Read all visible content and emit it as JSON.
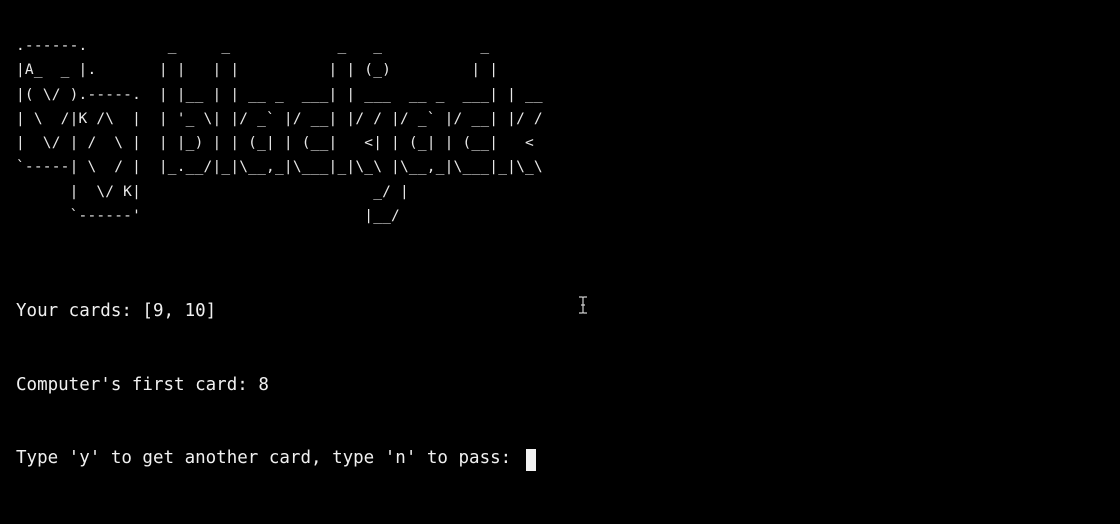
{
  "terminal": {
    "ascii_art": [
      ".------.         _     _            _   _           _",
      "|A_  _ |.       | |   | |          | | (_)         | |",
      "|( \\/ ).-----.  | |__ | | __ _  ___| | ___  __ _  ___| | __",
      "| \\  /|K /\\  |  | '_ \\| |/ _` |/ __| |/ / |/ _` |/ __| |/ /",
      "|  \\/ | /  \\ |  | |_) | | (_| | (__|   <| | (_| | (__|   <",
      "`-----| \\  / |  |_.__/|_|\\__,_|\\___|_|\\_\\ |\\__,_|\\___|_|\\_\\",
      "      |  \\/ K|                          _/ |",
      "      `------'                         |__/"
    ],
    "output_lines": [
      "Your cards: [9, 10]",
      "Computer's first card: 8"
    ],
    "prompt": "Type 'y' to get another card, type 'n' to pass: ",
    "input_value": ""
  }
}
